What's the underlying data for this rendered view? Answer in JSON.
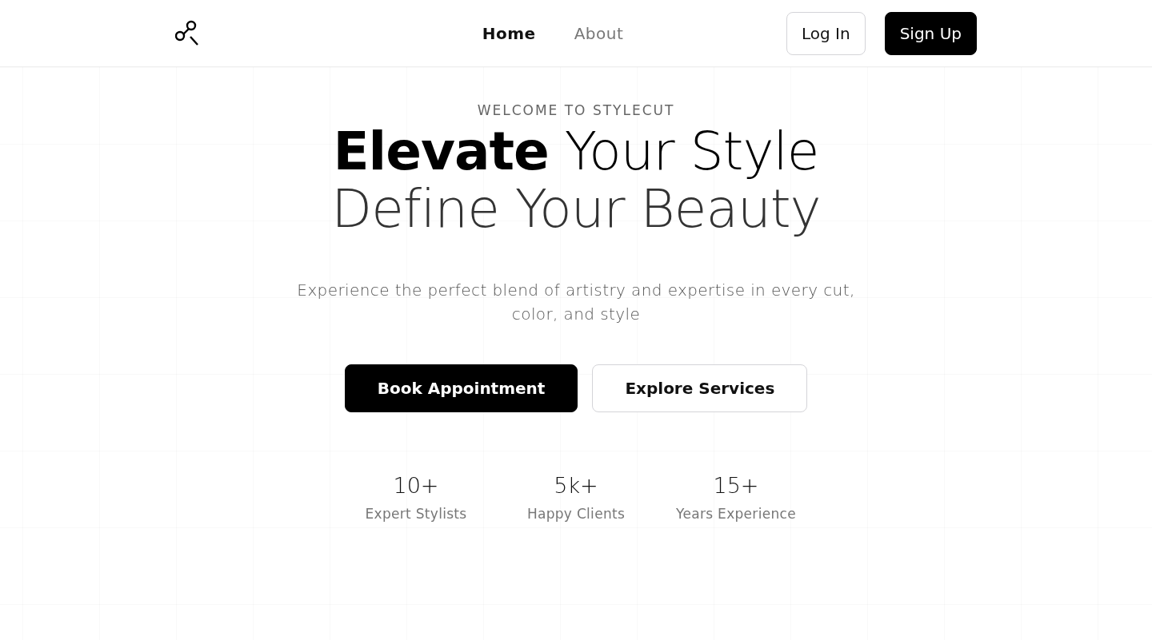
{
  "header": {
    "nav": [
      {
        "label": "Home",
        "selected": true
      },
      {
        "label": "About",
        "selected": false
      }
    ],
    "actions": [
      {
        "label": "Log In",
        "kind": "outline"
      },
      {
        "label": "Sign Up",
        "kind": "solid"
      }
    ]
  },
  "hero": {
    "eyebrow": "WELCOME TO STYLECUT",
    "headline": [
      "**Elevate** Your Style",
      "Define Your Beauty"
    ],
    "description": "Experience the perfect blend of artistry and expertise in every cut, color, and style",
    "buttons": [
      {
        "label": "Book Appointment",
        "kind": "solid"
      },
      {
        "label": "Explore Services",
        "kind": "outline"
      }
    ]
  },
  "stats": [
    {
      "value": "10+",
      "label": "Expert Stylists"
    },
    {
      "value": "5k+",
      "label": "Happy Clients"
    },
    {
      "value": "15+",
      "label": "Years Experience"
    }
  ]
}
